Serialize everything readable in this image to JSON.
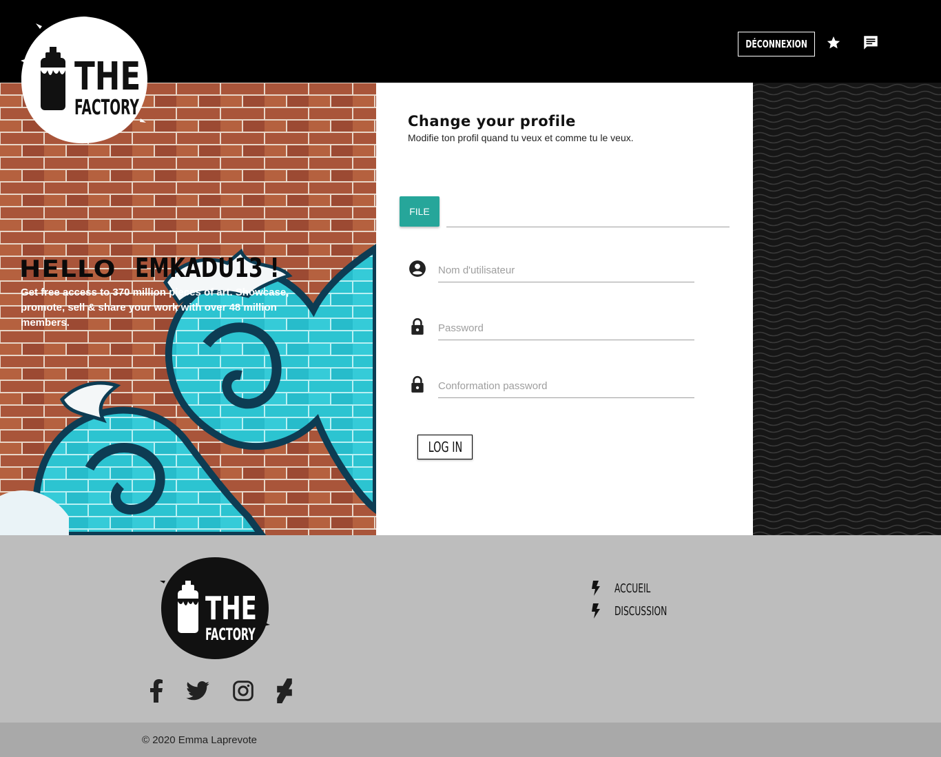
{
  "header": {
    "brand": {
      "line1": "THE",
      "line2": "FACTORY"
    },
    "logout_label": "DÉCONNEXION",
    "icons": [
      "star-icon",
      "message-icon"
    ]
  },
  "hero": {
    "greeting": "HELLO",
    "username": "EMKADU13 !",
    "pitch": "Get free access to 370 million pieces of art. Showcase, promote, sell & share your work with over 48 million members."
  },
  "form": {
    "title": "Change your profile",
    "subtitle": "Modifie ton profil quand tu veux et comme tu le veux.",
    "file_label": "FILE",
    "file_value": "",
    "fields": [
      {
        "icon": "account-circle-icon",
        "placeholder": "Nom d'utilisateur",
        "value": ""
      },
      {
        "icon": "lock-icon",
        "placeholder": "Password",
        "value": ""
      },
      {
        "icon": "lock-icon",
        "placeholder": "Conformation password",
        "value": ""
      }
    ],
    "submit_label": "LOG IN"
  },
  "footer": {
    "brand": {
      "line1": "THE",
      "line2": "FACTORY"
    },
    "social": [
      "facebook-icon",
      "twitter-icon",
      "instagram-icon",
      "deviantart-icon"
    ],
    "links": [
      {
        "icon": "bolt-icon",
        "label": "ACCUEIL"
      },
      {
        "icon": "bolt-icon",
        "label": "DISCUSSION"
      }
    ],
    "copyright": "© 2020 Emma Laprevote"
  },
  "colors": {
    "header_bg": "#000000",
    "accent_teal": "#26a69a",
    "footer_bg": "#bdbdbd",
    "copyright_bg": "#a9a9a9"
  }
}
